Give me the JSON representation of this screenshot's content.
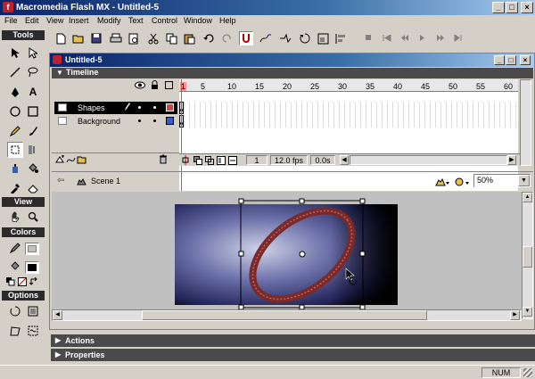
{
  "app": {
    "title": "Macromedia Flash MX - Untitled-5"
  },
  "menu": [
    "File",
    "Edit",
    "View",
    "Insert",
    "Modify",
    "Text",
    "Control",
    "Window",
    "Help"
  ],
  "window_buttons": {
    "minimize": "_",
    "maximize": "□",
    "close": "×"
  },
  "tools": {
    "header": "Tools",
    "view_header": "View",
    "colors_header": "Colors",
    "options_header": "Options"
  },
  "document": {
    "title": "Untitled-5",
    "timeline_label": "Timeline",
    "frame_numbers": [
      "1",
      "5",
      "10",
      "15",
      "20",
      "25",
      "30",
      "35",
      "40",
      "45",
      "50",
      "55",
      "60"
    ],
    "layers": [
      {
        "name": "Shapes",
        "color": "#e04040",
        "selected": true
      },
      {
        "name": "Background",
        "color": "#3060d0",
        "selected": false
      }
    ],
    "status": {
      "frame": "1",
      "fps": "12.0 fps",
      "time": "0.0s"
    },
    "scene": "Scene 1",
    "zoom": "50%"
  },
  "panels": {
    "actions": "Actions",
    "properties": "Properties"
  },
  "statusbar": {
    "num": "NUM"
  }
}
